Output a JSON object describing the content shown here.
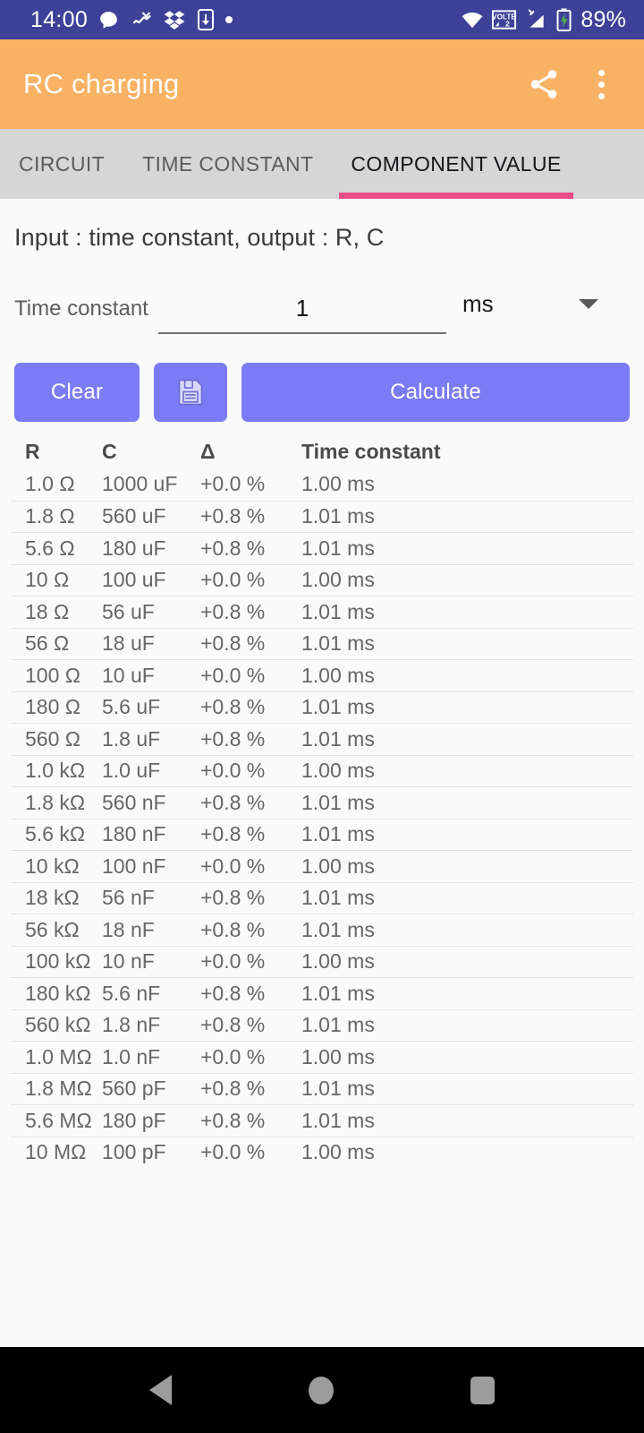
{
  "status_bar": {
    "time": "14:00",
    "battery_percent": "89%",
    "icons": [
      "message-icon",
      "missed-call-icon",
      "dropbox-icon",
      "download-to-phone-icon",
      "dot-icon"
    ],
    "right_icons": [
      "wifi-icon",
      "volte-2-icon",
      "no-signal-icon",
      "battery-charging-icon"
    ],
    "background": "#3d4298"
  },
  "app_bar": {
    "title": "RC charging",
    "share_label": "share",
    "overflow_label": "more options",
    "background": "#f9b264"
  },
  "tabs": {
    "items": [
      {
        "label": "CIRCUIT",
        "active": false
      },
      {
        "label": "TIME CONSTANT",
        "active": false
      },
      {
        "label": "COMPONENT VALUE",
        "active": true
      }
    ],
    "indicator_color": "#e94e87",
    "background": "#d6d6d6"
  },
  "main": {
    "subtitle": "Input : time constant, output : R, C",
    "input": {
      "label": "Time constant",
      "value": "1",
      "placeholder": "",
      "unit": "ms"
    },
    "buttons": {
      "clear": "Clear",
      "save": "save-icon",
      "calculate": "Calculate",
      "color": "#7b7bf5"
    },
    "table": {
      "headers": [
        "R",
        "C",
        "Δ",
        "Time constant"
      ],
      "rows": [
        [
          "1.0 Ω",
          "1000 uF",
          "+0.0 %",
          "1.00 ms"
        ],
        [
          "1.8 Ω",
          "560 uF",
          "+0.8 %",
          "1.01 ms"
        ],
        [
          "5.6 Ω",
          "180 uF",
          "+0.8 %",
          "1.01 ms"
        ],
        [
          "10 Ω",
          "100 uF",
          "+0.0 %",
          "1.00 ms"
        ],
        [
          "18 Ω",
          "56 uF",
          "+0.8 %",
          "1.01 ms"
        ],
        [
          "56 Ω",
          "18 uF",
          "+0.8 %",
          "1.01 ms"
        ],
        [
          "100 Ω",
          "10 uF",
          "+0.0 %",
          "1.00 ms"
        ],
        [
          "180 Ω",
          "5.6 uF",
          "+0.8 %",
          "1.01 ms"
        ],
        [
          "560 Ω",
          "1.8 uF",
          "+0.8 %",
          "1.01 ms"
        ],
        [
          "1.0 kΩ",
          "1.0 uF",
          "+0.0 %",
          "1.00 ms"
        ],
        [
          "1.8 kΩ",
          "560 nF",
          "+0.8 %",
          "1.01 ms"
        ],
        [
          "5.6 kΩ",
          "180 nF",
          "+0.8 %",
          "1.01 ms"
        ],
        [
          "10 kΩ",
          "100 nF",
          "+0.0 %",
          "1.00 ms"
        ],
        [
          "18 kΩ",
          "56 nF",
          "+0.8 %",
          "1.01 ms"
        ],
        [
          "56 kΩ",
          "18 nF",
          "+0.8 %",
          "1.01 ms"
        ],
        [
          "100 kΩ",
          "10 nF",
          "+0.0 %",
          "1.00 ms"
        ],
        [
          "180 kΩ",
          "5.6 nF",
          "+0.8 %",
          "1.01 ms"
        ],
        [
          "560 kΩ",
          "1.8 nF",
          "+0.8 %",
          "1.01 ms"
        ],
        [
          "1.0 MΩ",
          "1.0 nF",
          "+0.0 %",
          "1.00 ms"
        ],
        [
          "1.8 MΩ",
          "560 pF",
          "+0.8 %",
          "1.01 ms"
        ],
        [
          "5.6 MΩ",
          "180 pF",
          "+0.8 %",
          "1.01 ms"
        ],
        [
          "10 MΩ",
          "100 pF",
          "+0.0 %",
          "1.00 ms"
        ]
      ]
    }
  },
  "nav_bar": {
    "back": "back-icon",
    "home": "home-icon",
    "recents": "recents-icon"
  }
}
